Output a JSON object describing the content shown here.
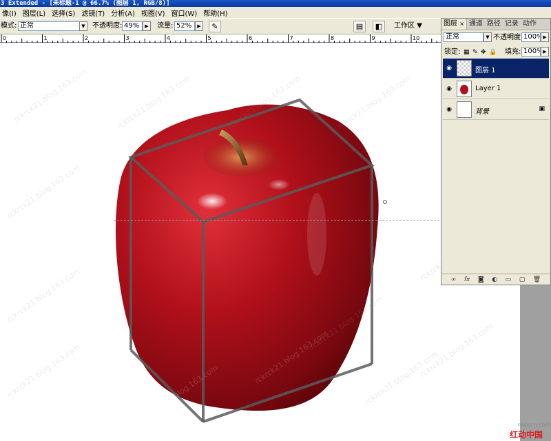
{
  "titlebar": {
    "text": "3 Extended - [未标题-1 @ 66.7% (图层 1, RGB/8)]"
  },
  "menu": [
    "像(I)",
    "图层(L)",
    "选择(S)",
    "滤镜(T)",
    "分析(A)",
    "视图(V)",
    "窗口(W)",
    "帮助(H)"
  ],
  "options": {
    "mode_label": "模式:",
    "mode_value": "正常",
    "opacity_label": "不透明度:",
    "opacity_value": "49%",
    "flow_label": "流量:",
    "flow_value": "52%",
    "workspace_label": "工作区",
    "workspace_arrow": "▼"
  },
  "ruler": {
    "labels": [
      "0",
      "1",
      "2",
      "3",
      "4",
      "5",
      "6",
      "7",
      "8",
      "9",
      "10"
    ]
  },
  "panel": {
    "tabs": [
      "图层",
      "通道",
      "路径",
      "记录",
      "动作"
    ],
    "blend_mode": "正常",
    "opacity_label": "不透明度:",
    "opacity_value": "100%",
    "lock_label": "锁定:",
    "fill_label": "填充:",
    "fill_value": "100%",
    "layers": [
      {
        "name": "图层 1",
        "selected": true
      },
      {
        "name": "Layer 1",
        "selected": false
      },
      {
        "name": "背景",
        "selected": false,
        "locked": true
      }
    ],
    "bottom_icons": [
      "link-icon",
      "fx-icon",
      "mask-icon",
      "adjustment-icon",
      "group-icon",
      "new-layer-icon",
      "trash-icon"
    ]
  },
  "watermarks": {
    "blog": "rckrck21.blog.163.com",
    "site_url": "redocn.com",
    "site_name": "红动中国"
  },
  "colors": {
    "selection": "#0a246a",
    "apple_red": "#b0101a",
    "cube_stroke": "#5a5a5a",
    "site_red": "#d82020"
  }
}
